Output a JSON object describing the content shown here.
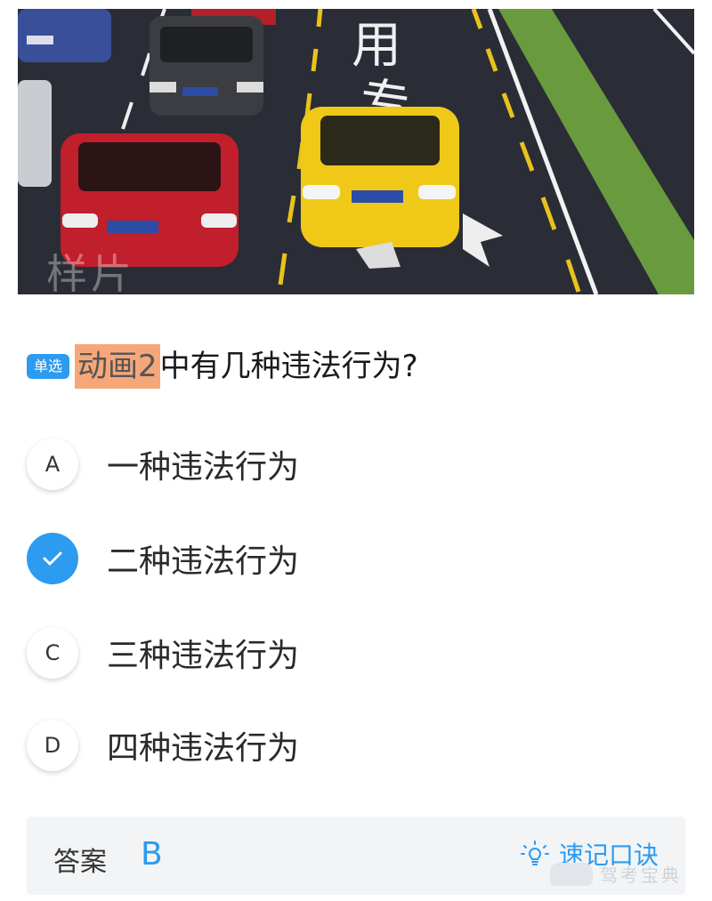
{
  "image": {
    "watermark": "样片",
    "road_marking": [
      "用",
      "专"
    ]
  },
  "question": {
    "type_badge": "单选",
    "highlight": "动画2",
    "text": "中有几种违法行为?"
  },
  "options": [
    {
      "key": "A",
      "text": "一种违法行为",
      "selected": false
    },
    {
      "key": "B",
      "text": "二种违法行为",
      "selected": true
    },
    {
      "key": "C",
      "text": "三种违法行为",
      "selected": false
    },
    {
      "key": "D",
      "text": "四种违法行为",
      "selected": false
    }
  ],
  "answer": {
    "label": "答案",
    "value": "B",
    "mnemonic_label": "速记口诀",
    "mnemonic_icon": "lightbulb-icon"
  },
  "brand_watermark": "驾考宝典",
  "colors": {
    "accent": "#2c9bf0",
    "highlight": "#f6a77a",
    "answer_bg": "#f2f4f6"
  }
}
